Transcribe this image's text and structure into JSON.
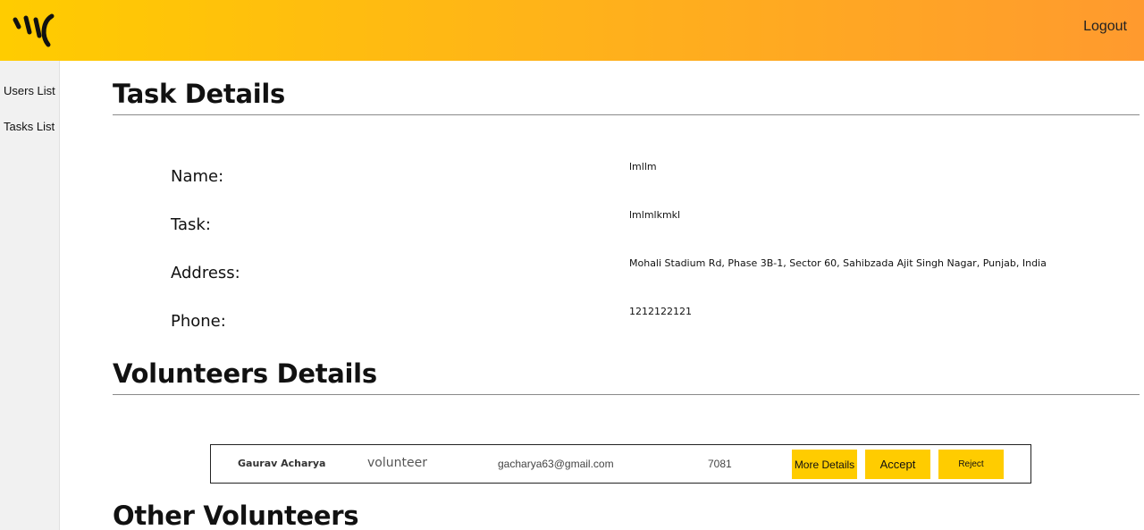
{
  "header": {
    "logo_icon": "brand-logo-icon",
    "logout_label": "Logout",
    "gradient_colors": [
      "#ffcc00",
      "#ffb21a",
      "#ff9a2e"
    ]
  },
  "sidebar": {
    "items": [
      {
        "label": "Users List"
      },
      {
        "label": "Tasks List"
      }
    ]
  },
  "task_section": {
    "title": "Task Details",
    "fields": [
      {
        "label": "Name:",
        "value": "lmllm"
      },
      {
        "label": "Task:",
        "value": "lmlmlkmkl"
      },
      {
        "label": "Address:",
        "value": "Mohali Stadium Rd, Phase 3B-1, Sector 60, Sahibzada Ajit Singh Nagar, Punjab, India"
      },
      {
        "label": "Phone:",
        "value": "1212122121"
      }
    ]
  },
  "volunteers_section": {
    "title": "Volunteers Details",
    "rows": [
      {
        "name": "Gaurav Acharya",
        "role": "volunteer",
        "email": "gacharya63@gmail.com",
        "phone": "7081",
        "more_label": "More Details",
        "accept_label": "Accept",
        "reject_label": "Reject"
      }
    ]
  },
  "other_section": {
    "title": "Other Volunteers"
  },
  "accent_color": "#ffcc00"
}
